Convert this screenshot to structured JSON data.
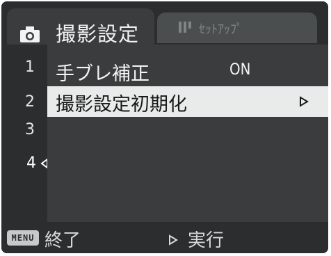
{
  "tabs": {
    "active": {
      "label": "撮影設定",
      "icon": "camera-icon"
    },
    "inactive": {
      "label": "ｾｯﾄｱｯﾌﾟ",
      "icon": "setup-icon"
    }
  },
  "sidebar": {
    "pages": [
      "1",
      "2",
      "3",
      "4"
    ],
    "current_page": "4"
  },
  "menu": {
    "items": [
      {
        "label": "手ブレ補正",
        "value": "ON"
      },
      {
        "label": "撮影設定初期化",
        "arrow": "play-right-icon",
        "selected": true
      }
    ]
  },
  "bottom": {
    "menu_badge": "MENU",
    "exit_label": "終了",
    "exec_label": "実行"
  },
  "colors": {
    "background": "#2b2d2e",
    "panel": "#3a3c3d",
    "highlight": "#e9eaea",
    "text": "#f5f5f5"
  }
}
